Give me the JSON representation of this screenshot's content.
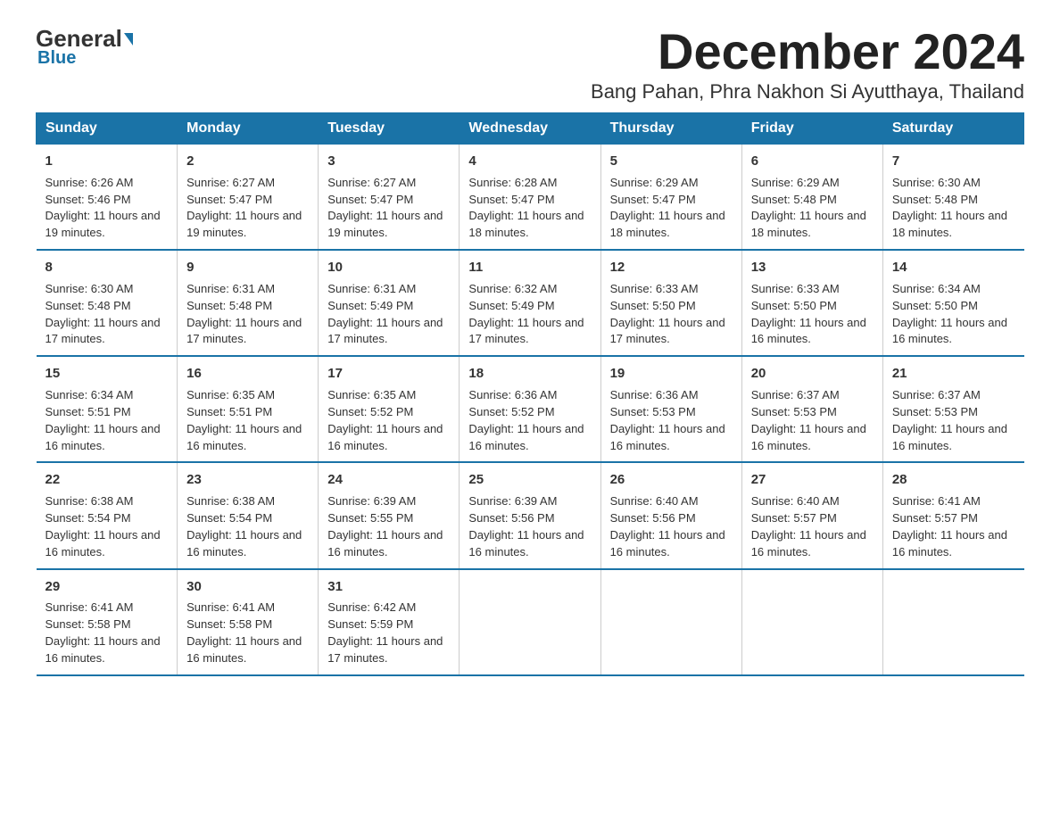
{
  "logo": {
    "general": "General",
    "blue": "Blue"
  },
  "title": {
    "month": "December 2024",
    "location": "Bang Pahan, Phra Nakhon Si Ayutthaya, Thailand"
  },
  "headers": [
    "Sunday",
    "Monday",
    "Tuesday",
    "Wednesday",
    "Thursday",
    "Friday",
    "Saturday"
  ],
  "weeks": [
    [
      {
        "day": "1",
        "sunrise": "6:26 AM",
        "sunset": "5:46 PM",
        "daylight": "11 hours and 19 minutes."
      },
      {
        "day": "2",
        "sunrise": "6:27 AM",
        "sunset": "5:47 PM",
        "daylight": "11 hours and 19 minutes."
      },
      {
        "day": "3",
        "sunrise": "6:27 AM",
        "sunset": "5:47 PM",
        "daylight": "11 hours and 19 minutes."
      },
      {
        "day": "4",
        "sunrise": "6:28 AM",
        "sunset": "5:47 PM",
        "daylight": "11 hours and 18 minutes."
      },
      {
        "day": "5",
        "sunrise": "6:29 AM",
        "sunset": "5:47 PM",
        "daylight": "11 hours and 18 minutes."
      },
      {
        "day": "6",
        "sunrise": "6:29 AM",
        "sunset": "5:48 PM",
        "daylight": "11 hours and 18 minutes."
      },
      {
        "day": "7",
        "sunrise": "6:30 AM",
        "sunset": "5:48 PM",
        "daylight": "11 hours and 18 minutes."
      }
    ],
    [
      {
        "day": "8",
        "sunrise": "6:30 AM",
        "sunset": "5:48 PM",
        "daylight": "11 hours and 17 minutes."
      },
      {
        "day": "9",
        "sunrise": "6:31 AM",
        "sunset": "5:48 PM",
        "daylight": "11 hours and 17 minutes."
      },
      {
        "day": "10",
        "sunrise": "6:31 AM",
        "sunset": "5:49 PM",
        "daylight": "11 hours and 17 minutes."
      },
      {
        "day": "11",
        "sunrise": "6:32 AM",
        "sunset": "5:49 PM",
        "daylight": "11 hours and 17 minutes."
      },
      {
        "day": "12",
        "sunrise": "6:33 AM",
        "sunset": "5:50 PM",
        "daylight": "11 hours and 17 minutes."
      },
      {
        "day": "13",
        "sunrise": "6:33 AM",
        "sunset": "5:50 PM",
        "daylight": "11 hours and 16 minutes."
      },
      {
        "day": "14",
        "sunrise": "6:34 AM",
        "sunset": "5:50 PM",
        "daylight": "11 hours and 16 minutes."
      }
    ],
    [
      {
        "day": "15",
        "sunrise": "6:34 AM",
        "sunset": "5:51 PM",
        "daylight": "11 hours and 16 minutes."
      },
      {
        "day": "16",
        "sunrise": "6:35 AM",
        "sunset": "5:51 PM",
        "daylight": "11 hours and 16 minutes."
      },
      {
        "day": "17",
        "sunrise": "6:35 AM",
        "sunset": "5:52 PM",
        "daylight": "11 hours and 16 minutes."
      },
      {
        "day": "18",
        "sunrise": "6:36 AM",
        "sunset": "5:52 PM",
        "daylight": "11 hours and 16 minutes."
      },
      {
        "day": "19",
        "sunrise": "6:36 AM",
        "sunset": "5:53 PM",
        "daylight": "11 hours and 16 minutes."
      },
      {
        "day": "20",
        "sunrise": "6:37 AM",
        "sunset": "5:53 PM",
        "daylight": "11 hours and 16 minutes."
      },
      {
        "day": "21",
        "sunrise": "6:37 AM",
        "sunset": "5:53 PM",
        "daylight": "11 hours and 16 minutes."
      }
    ],
    [
      {
        "day": "22",
        "sunrise": "6:38 AM",
        "sunset": "5:54 PM",
        "daylight": "11 hours and 16 minutes."
      },
      {
        "day": "23",
        "sunrise": "6:38 AM",
        "sunset": "5:54 PM",
        "daylight": "11 hours and 16 minutes."
      },
      {
        "day": "24",
        "sunrise": "6:39 AM",
        "sunset": "5:55 PM",
        "daylight": "11 hours and 16 minutes."
      },
      {
        "day": "25",
        "sunrise": "6:39 AM",
        "sunset": "5:56 PM",
        "daylight": "11 hours and 16 minutes."
      },
      {
        "day": "26",
        "sunrise": "6:40 AM",
        "sunset": "5:56 PM",
        "daylight": "11 hours and 16 minutes."
      },
      {
        "day": "27",
        "sunrise": "6:40 AM",
        "sunset": "5:57 PM",
        "daylight": "11 hours and 16 minutes."
      },
      {
        "day": "28",
        "sunrise": "6:41 AM",
        "sunset": "5:57 PM",
        "daylight": "11 hours and 16 minutes."
      }
    ],
    [
      {
        "day": "29",
        "sunrise": "6:41 AM",
        "sunset": "5:58 PM",
        "daylight": "11 hours and 16 minutes."
      },
      {
        "day": "30",
        "sunrise": "6:41 AM",
        "sunset": "5:58 PM",
        "daylight": "11 hours and 16 minutes."
      },
      {
        "day": "31",
        "sunrise": "6:42 AM",
        "sunset": "5:59 PM",
        "daylight": "11 hours and 17 minutes."
      },
      null,
      null,
      null,
      null
    ]
  ],
  "labels": {
    "sunrise_prefix": "Sunrise: ",
    "sunset_prefix": "Sunset: ",
    "daylight_prefix": "Daylight: "
  }
}
